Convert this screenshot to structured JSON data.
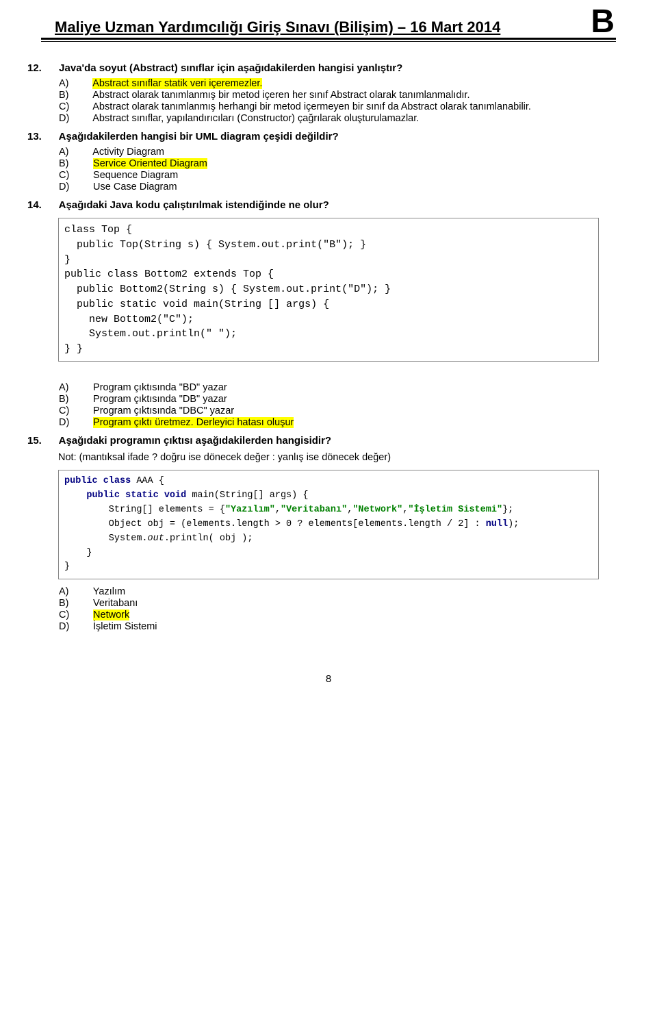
{
  "header": {
    "title": "Maliye Uzman Yardımcılığı Giriş Sınavı (Bilişim) – 16 Mart 2014",
    "letter": "B"
  },
  "page_number": "8",
  "q12": {
    "num": "12.",
    "text": "Java'da soyut (Abstract) sınıflar için aşağıdakilerden hangisi yanlıştır?",
    "a": "Abstract sınıflar statik veri içeremezler.",
    "b": "Abstract olarak tanımlanmış bir metod içeren her sınıf Abstract olarak tanımlanmalıdır.",
    "c": "Abstract olarak tanımlanmış herhangi bir metod içermeyen bir sınıf da Abstract olarak tanımlanabilir.",
    "d": "Abstract sınıflar, yapılandırıcıları (Constructor) çağrılarak oluşturulamazlar."
  },
  "q13": {
    "num": "13.",
    "text": "Aşağıdakilerden hangisi bir UML diagram çeşidi değildir?",
    "a": "Activity Diagram",
    "b": "Service Oriented Diagram",
    "c": "Sequence Diagram",
    "d": "Use Case Diagram"
  },
  "q14": {
    "num": "14.",
    "text": "Aşağıdaki Java kodu çalıştırılmak istendiğinde ne olur?",
    "code": "class Top {\n  public Top(String s) { System.out.print(\"B\"); }\n}\npublic class Bottom2 extends Top {\n  public Bottom2(String s) { System.out.print(\"D\"); }\n  public static void main(String [] args) {\n    new Bottom2(\"C\");\n    System.out.println(\" \");\n} }",
    "a": "Program çıktısında \"BD\" yazar",
    "b": "Program çıktısında \"DB\" yazar",
    "c": "Program çıktısında \"DBC\" yazar",
    "d": "Program çıktı üretmez. Derleyici hatası oluşur"
  },
  "q15": {
    "num": "15.",
    "text": "Aşağıdaki programın çıktısı aşağıdakilerden hangisidir?",
    "note": "Not: (mantıksal ifade ? doğru ise dönecek değer : yanlış ise dönecek değer)",
    "a": "Yazılım",
    "b": "Veritabanı",
    "c": "Network",
    "d": "İşletim Sistemi"
  },
  "labels": {
    "A": "A)",
    "B": "B)",
    "C": "C)",
    "D": "D)"
  }
}
